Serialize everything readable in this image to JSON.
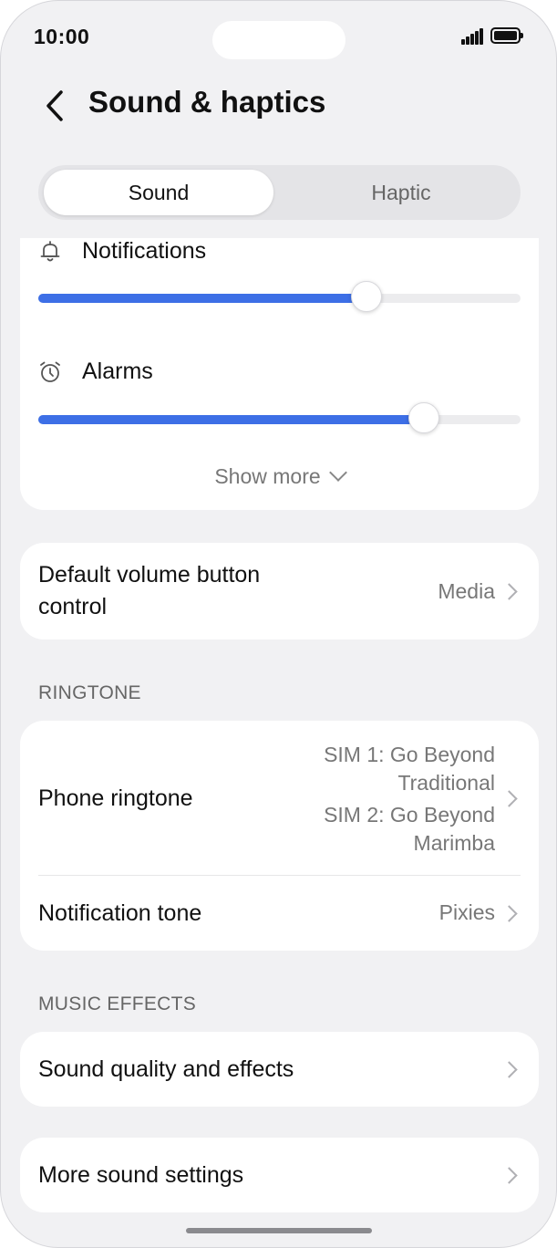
{
  "status_bar": {
    "time": "10:00"
  },
  "header": {
    "title": "Sound & haptics"
  },
  "segment": {
    "sound_label": "Sound",
    "haptic_label": "Haptic",
    "selected": "Sound"
  },
  "volume": {
    "notifications": {
      "label": "Notifications",
      "level": 0.68
    },
    "alarms": {
      "label": "Alarms",
      "level": 0.8
    },
    "show_more_label": "Show more"
  },
  "default_volume": {
    "label": "Default volume button control",
    "value": "Media"
  },
  "ringtone": {
    "section_label": "RINGTONE",
    "phone_ringtone": {
      "label": "Phone ringtone",
      "sim1_value": "SIM 1: Go Beyond Traditional",
      "sim2_value": "SIM 2: Go Beyond Marimba"
    },
    "notification_tone": {
      "label": "Notification tone",
      "value": "Pixies"
    }
  },
  "music_effects": {
    "section_label": "MUSIC EFFECTS",
    "sound_quality_label": "Sound quality and effects"
  },
  "more_sound_settings_label": "More sound settings",
  "colors": {
    "accent": "#3d6fe6",
    "background": "#f1f1f3",
    "card": "#ffffff"
  },
  "icons": [
    "back-arrow-icon",
    "bell-icon",
    "alarm-clock-icon",
    "chevron-down-icon",
    "chevron-right-icon",
    "signal-icon",
    "battery-icon"
  ]
}
